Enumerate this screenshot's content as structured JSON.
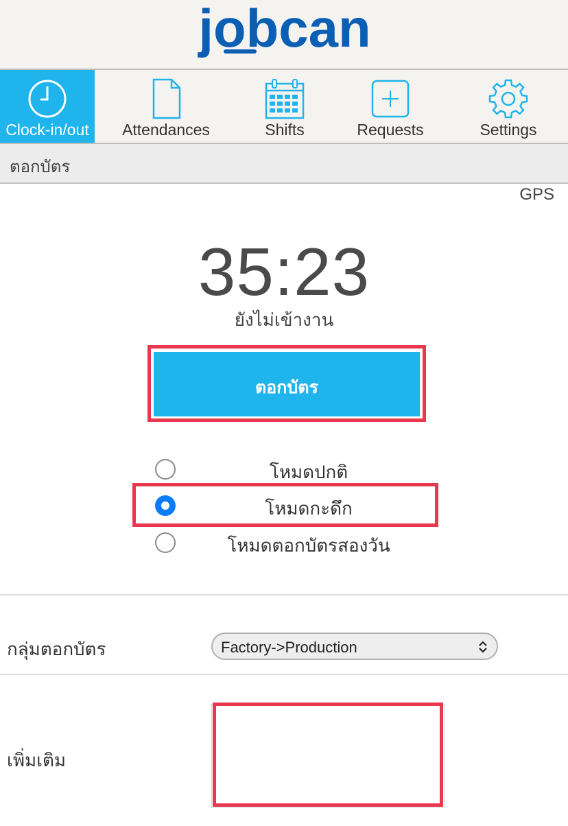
{
  "header": {
    "logo_text": "jobcan",
    "brand_color": "#0a5fb4"
  },
  "nav": {
    "active_color": "#1fb4ec",
    "items": [
      {
        "label": "Clock-in/out",
        "icon": "clock-icon",
        "active": true
      },
      {
        "label": "Attendances",
        "icon": "document-icon",
        "active": false
      },
      {
        "label": "Shifts",
        "icon": "calendar-icon",
        "active": false
      },
      {
        "label": "Requests",
        "icon": "plus-square-icon",
        "active": false
      },
      {
        "label": "Settings",
        "icon": "gear-icon",
        "active": false
      }
    ]
  },
  "page_title": "ตอกบัตร",
  "gps_label": "GPS",
  "clock": {
    "time": "35:23",
    "status": "ยังไม่เข้างาน"
  },
  "punch_button_label": "ตอกบัตร",
  "highlight_color": "#e9374f",
  "modes": [
    {
      "label": "โหมดปกติ",
      "checked": false
    },
    {
      "label": "โหมดกะดึก",
      "checked": true
    },
    {
      "label": "โหมดตอกบัตรสองวัน",
      "checked": false
    }
  ],
  "group": {
    "label": "กลุ่มตอกบัตร",
    "selected": "Factory->Production"
  },
  "notes": {
    "label": "เพิ่มเติม",
    "value": ""
  }
}
